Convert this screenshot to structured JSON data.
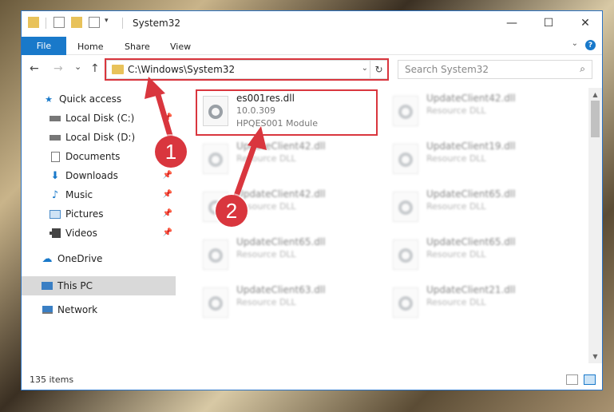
{
  "window": {
    "title": "System32",
    "controls": {
      "minimize": "—",
      "maximize": "☐",
      "close": "✕"
    }
  },
  "ribbon": {
    "file": "File",
    "tabs": [
      "Home",
      "Share",
      "View"
    ],
    "help": "?"
  },
  "navigation": {
    "back": "←",
    "forward": "→",
    "recent": "⌄",
    "up": "↑",
    "address": "C:\\Windows\\System32",
    "search_placeholder": "Search System32"
  },
  "sidebar": {
    "items": [
      {
        "label": "Quick access",
        "icon": "star-icon"
      },
      {
        "label": "Local Disk (C:)",
        "icon": "drive-icon"
      },
      {
        "label": "Local Disk (D:)",
        "icon": "drive-icon"
      },
      {
        "label": "Documents",
        "icon": "documents-icon"
      },
      {
        "label": "Downloads",
        "icon": "download-icon"
      },
      {
        "label": "Music",
        "icon": "music-icon"
      },
      {
        "label": "Pictures",
        "icon": "pictures-icon"
      },
      {
        "label": "Videos",
        "icon": "videos-icon"
      },
      {
        "label": "OneDrive",
        "icon": "cloud-icon"
      },
      {
        "label": "This PC",
        "icon": "computer-icon"
      },
      {
        "label": "Network",
        "icon": "network-icon"
      }
    ]
  },
  "files": [
    {
      "name": "es001res.dll",
      "line2": "10.0.309",
      "line3": "HPQES001 Module"
    },
    {
      "name": "UpdateClient42.dll",
      "line2": "Resource DLL"
    },
    {
      "name": "UpdateClient42.dll",
      "line2": "Resource DLL"
    },
    {
      "name": "UpdateClient19.dll",
      "line2": "Resource DLL"
    },
    {
      "name": "UpdateClient42.dll",
      "line2": "Resource DLL"
    },
    {
      "name": "UpdateClient65.dll",
      "line2": "Resource DLL"
    },
    {
      "name": "UpdateClient65.dll",
      "line2": "Resource DLL"
    },
    {
      "name": "UpdateClient65.dll",
      "line2": "Resource DLL"
    },
    {
      "name": "UpdateClient63.dll",
      "line2": "Resource DLL"
    },
    {
      "name": "UpdateClient21.dll",
      "line2": "Resource DLL"
    }
  ],
  "status": {
    "count": "135 items"
  },
  "annotations": {
    "step1": "1",
    "step2": "2"
  },
  "colors": {
    "accent": "#1979ca",
    "annotation": "#d9363e",
    "folder": "#e8c25a"
  }
}
